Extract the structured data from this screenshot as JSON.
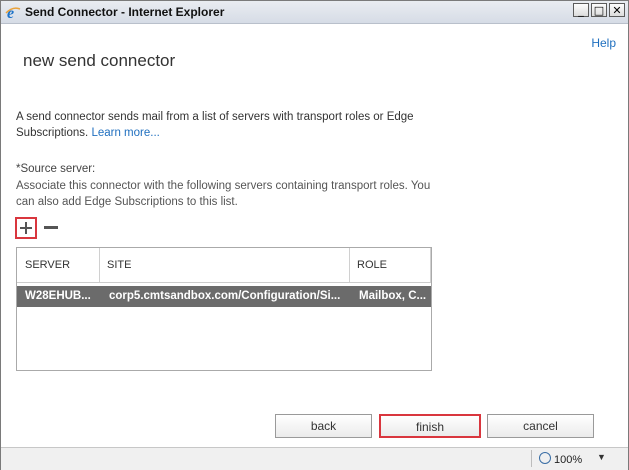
{
  "window": {
    "title": "Send Connector - Internet Explorer"
  },
  "help_link": "Help",
  "page_title": "new send connector",
  "description": {
    "text": "A send connector sends mail from a list of servers with transport roles or Edge Subscriptions.",
    "learn_more": "Learn more..."
  },
  "source_server": {
    "label": "*Source server:",
    "description": "Associate this connector with the following servers containing transport roles. You can also add Edge Subscriptions to this list."
  },
  "table": {
    "columns": [
      "SERVER",
      "SITE",
      "ROLE"
    ],
    "rows": [
      {
        "server": "W28EHUB...",
        "site": "corp5.cmtsandbox.com/Configuration/Si...",
        "role": "Mailbox, C..."
      }
    ]
  },
  "buttons": {
    "back": "back",
    "finish": "finish",
    "cancel": "cancel"
  },
  "statusbar": {
    "zoom": "100%"
  }
}
